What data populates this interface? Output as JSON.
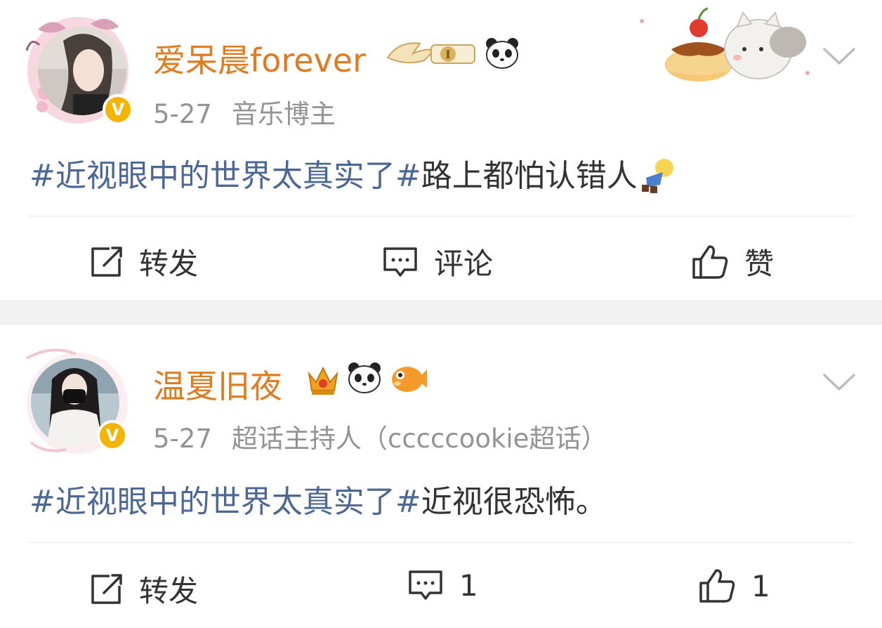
{
  "posts": [
    {
      "username": "爱呆晨forever",
      "date": "5-27",
      "tag": "音乐博主",
      "topic": "#近视眼中的世界太真实了#",
      "text": "路上都怕认错人",
      "verified_mark": "V",
      "badges": [
        "wing-level-badge-icon",
        "panda-emoji-icon"
      ],
      "actions": {
        "repost": "转发",
        "comment": "评论",
        "like": "赞"
      }
    },
    {
      "username": "温夏旧夜",
      "date": "5-27",
      "tag": "超话主持人（cccccookie超话）",
      "topic": "#近视眼中的世界太真实了#",
      "text": "近视很恐怖。",
      "verified_mark": "V",
      "badges": [
        "crown-badge-icon",
        "panda-emoji-icon",
        "pufferfish-emoji-icon"
      ],
      "actions": {
        "repost": "转发",
        "comment": "1",
        "like": "1"
      }
    }
  ],
  "colors": {
    "username": "#e07b1f",
    "topic": "#4a6796",
    "meta": "#939393",
    "badge": "#f5b400",
    "separator": "#f2f2f2"
  }
}
